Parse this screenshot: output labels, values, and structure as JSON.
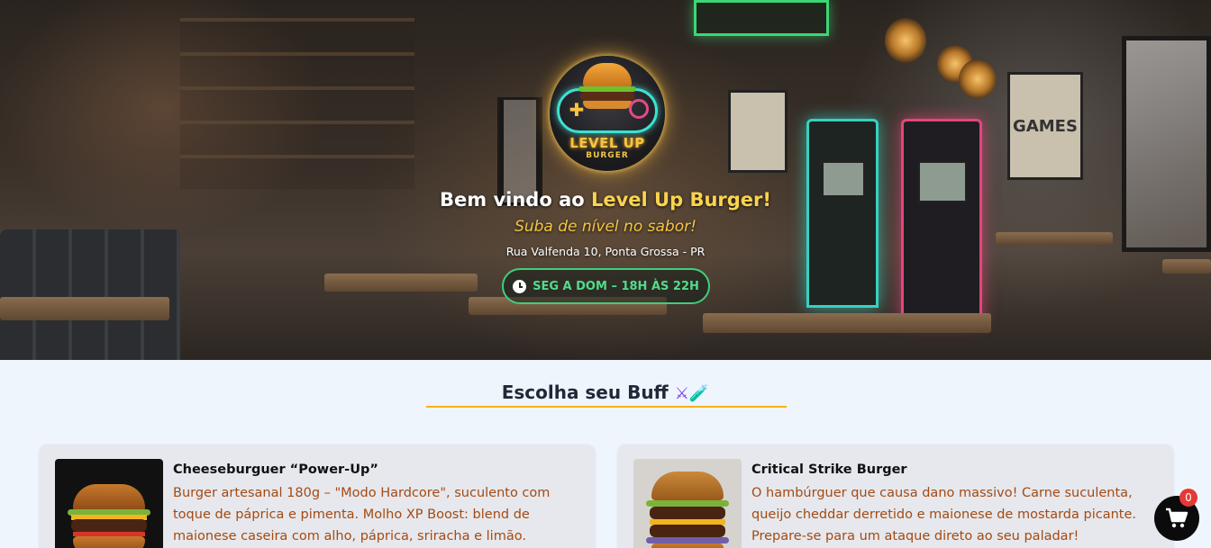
{
  "hero": {
    "welcome_prefix": "Bem vindo ao ",
    "brand_name": "Level Up Burger!",
    "tagline": "Suba de nível no sabor!",
    "address": "Rua Valfenda 10, Ponta Grossa - PR",
    "hours": "SEG A DOM – 18H ÀS 22H",
    "logo_line1": "LEVEL UP",
    "logo_line2": "BURGER",
    "poster_text": "GAMES"
  },
  "menu": {
    "section_title": "Escolha seu Buff",
    "section_emoji": "⚔🧪",
    "items": [
      {
        "name": "Cheeseburguer “Power-Up”",
        "description": "Burger artesanal 180g – \"Modo Hardcore\", suculento com toque de páprica e pimenta. Molho XP Boost: blend de maionese caseira com alho, páprica, sriracha e limão."
      },
      {
        "name": "Critical Strike Burger",
        "description": "O hambúrguer que causa dano massivo! Carne suculenta, queijo cheddar derretido e maionese de mostarda picante. Prepare-se para um ataque direto ao seu paladar!"
      }
    ]
  },
  "cart": {
    "count": "0"
  },
  "colors": {
    "brand_yellow": "#fcd34d",
    "hours_green": "#52dc8a",
    "description_brown": "#a44a12",
    "section_rule": "#f5b11c",
    "cart_badge": "#e53935"
  }
}
